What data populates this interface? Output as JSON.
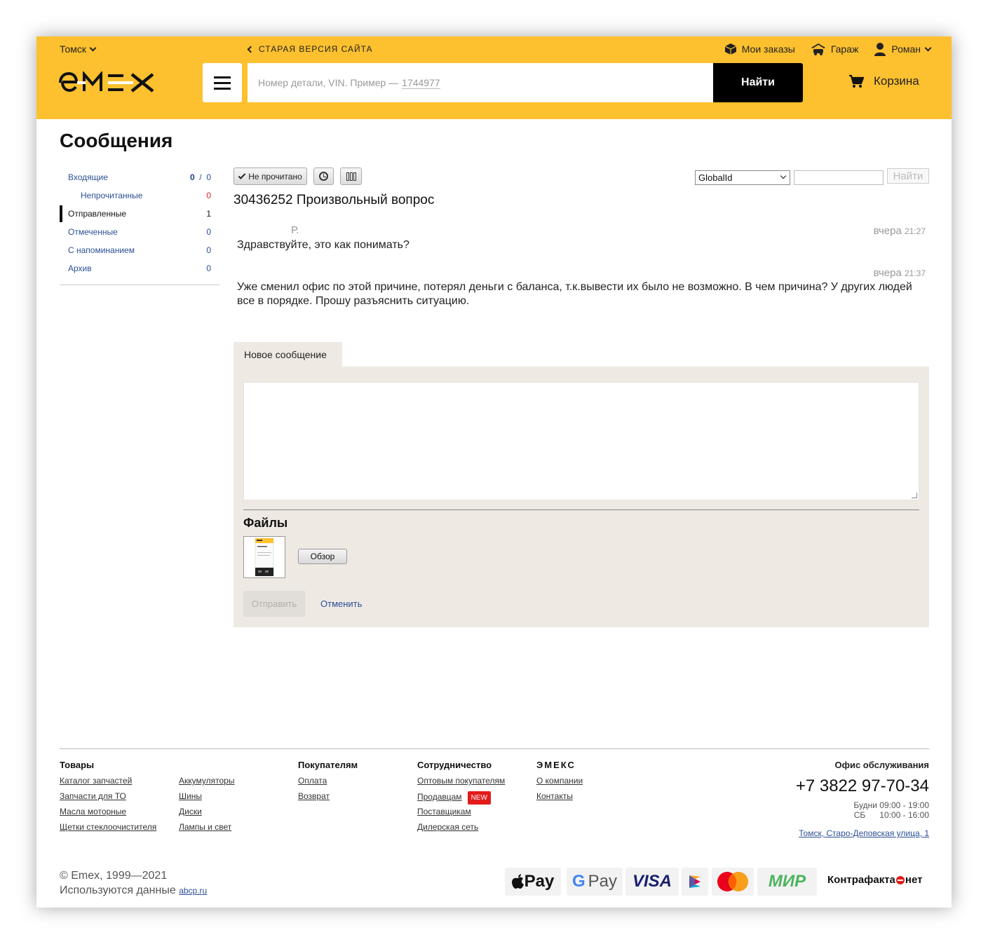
{
  "header": {
    "city": "Томск",
    "old_version": "СТАРАЯ ВЕРСИЯ САЙТА",
    "nav": {
      "orders": "Мои заказы",
      "garage": "Гараж",
      "user": "Роман"
    },
    "search_placeholder": "Номер детали, VIN. Пример —",
    "search_example": "1744977",
    "search_button": "Найти",
    "cart": "Корзина",
    "brand_color": "#fdc02f"
  },
  "page": {
    "title": "Сообщения"
  },
  "sidebar": {
    "items": [
      {
        "label": "Входящие",
        "count_bold": "0",
        "count_sep": "/",
        "count": "0"
      },
      {
        "label": "Непрочитанные",
        "count": "0"
      },
      {
        "label": "Отправленные",
        "count": "1"
      },
      {
        "label": "Отмеченные",
        "count": "0"
      },
      {
        "label": "С напоминанием",
        "count": "0"
      },
      {
        "label": "Архив",
        "count": "0"
      }
    ]
  },
  "toolbar": {
    "unread_label": "Не прочитано",
    "filter_selected": "GlobalId",
    "find_button": "Найти"
  },
  "thread": {
    "title": "30436252 Произвольный вопрос",
    "messages": [
      {
        "author": "Р.",
        "day": "вчера",
        "time": "21:27",
        "text": "Здравствуйте, это как понимать?"
      },
      {
        "author": "",
        "day": "вчера",
        "time": "21:37",
        "text": "Уже сменил офис по этой причине, потерял деньги с баланса, т.к.вывести их было не возможно. В чем причина? У других людей все в порядке. Прошу разъяснить ситуацию."
      }
    ]
  },
  "compose": {
    "tab": "Новое сообщение",
    "text_value": "",
    "files_title": "Файлы",
    "browse": "Обзор",
    "send": "Отправить",
    "cancel": "Отменить"
  },
  "footer": {
    "goods": {
      "heading": "Товары",
      "col1": [
        "Каталог запчастей",
        "Запчасти для ТО",
        "Масла моторные",
        "Щетки стеклоочистителя"
      ],
      "col2": [
        "Аккумуляторы",
        "Шины",
        "Диски",
        "Лампы и свет"
      ]
    },
    "buyers": {
      "heading": "Покупателям",
      "links": [
        "Оплата",
        "Возврат"
      ]
    },
    "coop": {
      "heading": "Сотрудничество",
      "links": [
        "Оптовым покупателям",
        "Продавцам",
        "Поставщикам",
        "Дилерская сеть"
      ],
      "new_badge": "NEW"
    },
    "emex": {
      "heading": "ЭМЕКС",
      "links": [
        "О компании",
        "Контакты"
      ]
    },
    "office": {
      "heading": "Офис обслуживания",
      "phone": "+7 3822 97-70-34",
      "weekdays_label": "Будни",
      "weekdays_hours": "09:00 - 19:00",
      "sat_label": "СБ",
      "sat_hours": "10:00 - 16:00",
      "address": "Томск, Старо-Деповская улица, 1"
    },
    "copyright": "© Emex, 1999—2021",
    "data_used": "Используются данные",
    "data_link": "abcp.ru",
    "payments": {
      "apple": "Pay",
      "google": "Pay",
      "visa": "VISA",
      "mir": "МИР",
      "counterfeit_left": "Контрафакта",
      "counterfeit_right": "нет"
    }
  }
}
